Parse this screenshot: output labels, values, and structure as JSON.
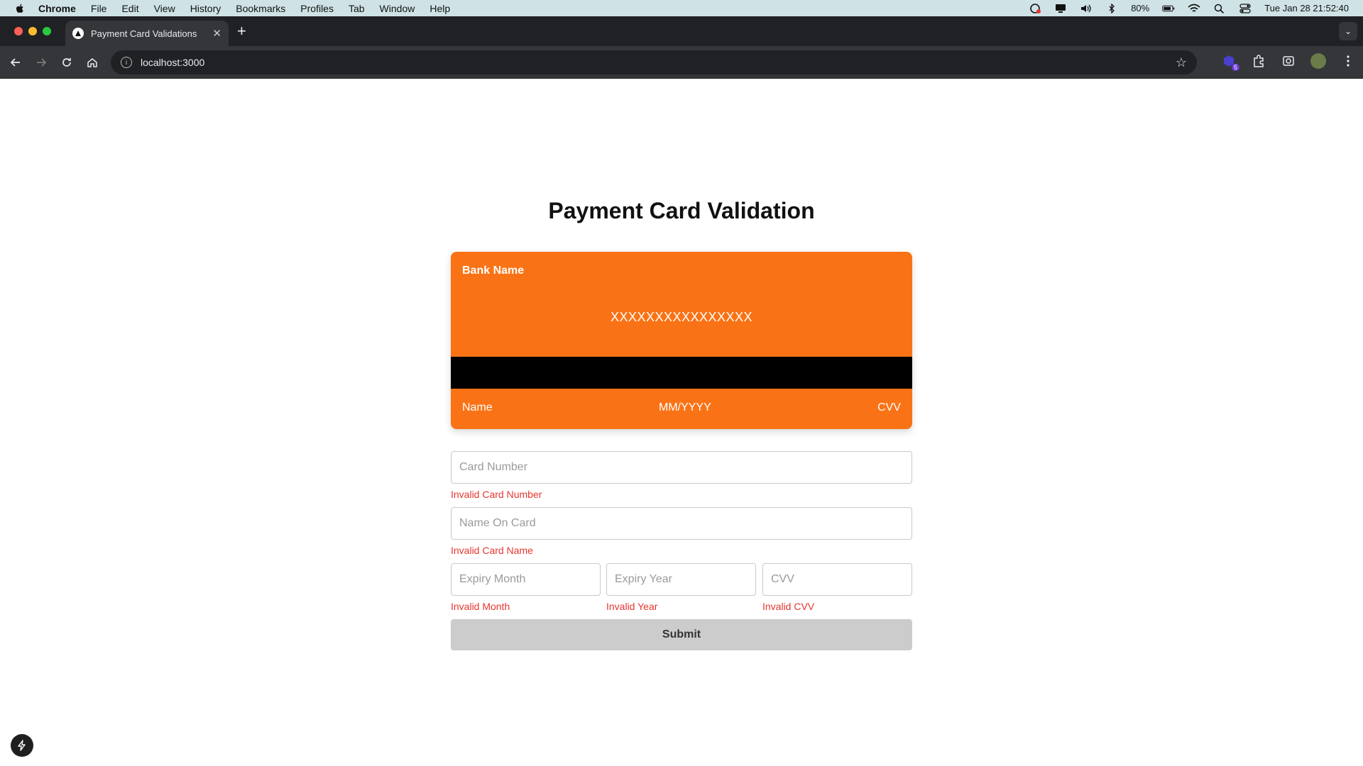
{
  "menubar": {
    "app": "Chrome",
    "items": [
      "File",
      "Edit",
      "View",
      "History",
      "Bookmarks",
      "Profiles",
      "Tab",
      "Window",
      "Help"
    ],
    "battery": "80%",
    "datetime": "Tue Jan 28  21:52:40"
  },
  "browser": {
    "tab_title": "Payment Card Validations",
    "url": "localhost:3000",
    "extension_badge": "5"
  },
  "page": {
    "title": "Payment Card Validation",
    "card": {
      "bank_name": "Bank Name",
      "number": "XXXXXXXXXXXXXXXX",
      "name": "Name",
      "expiry": "MM/YYYY",
      "cvv": "CVV",
      "color": "#f97316"
    },
    "form": {
      "card_number_placeholder": "Card Number",
      "card_number_error": "Invalid Card Number",
      "name_placeholder": "Name On Card",
      "name_error": "Invalid Card Name",
      "month_placeholder": "Expiry Month",
      "month_error": "Invalid Month",
      "year_placeholder": "Expiry Year",
      "year_error": "Invalid Year",
      "cvv_placeholder": "CVV",
      "cvv_error": "Invalid CVV",
      "submit_label": "Submit"
    }
  }
}
